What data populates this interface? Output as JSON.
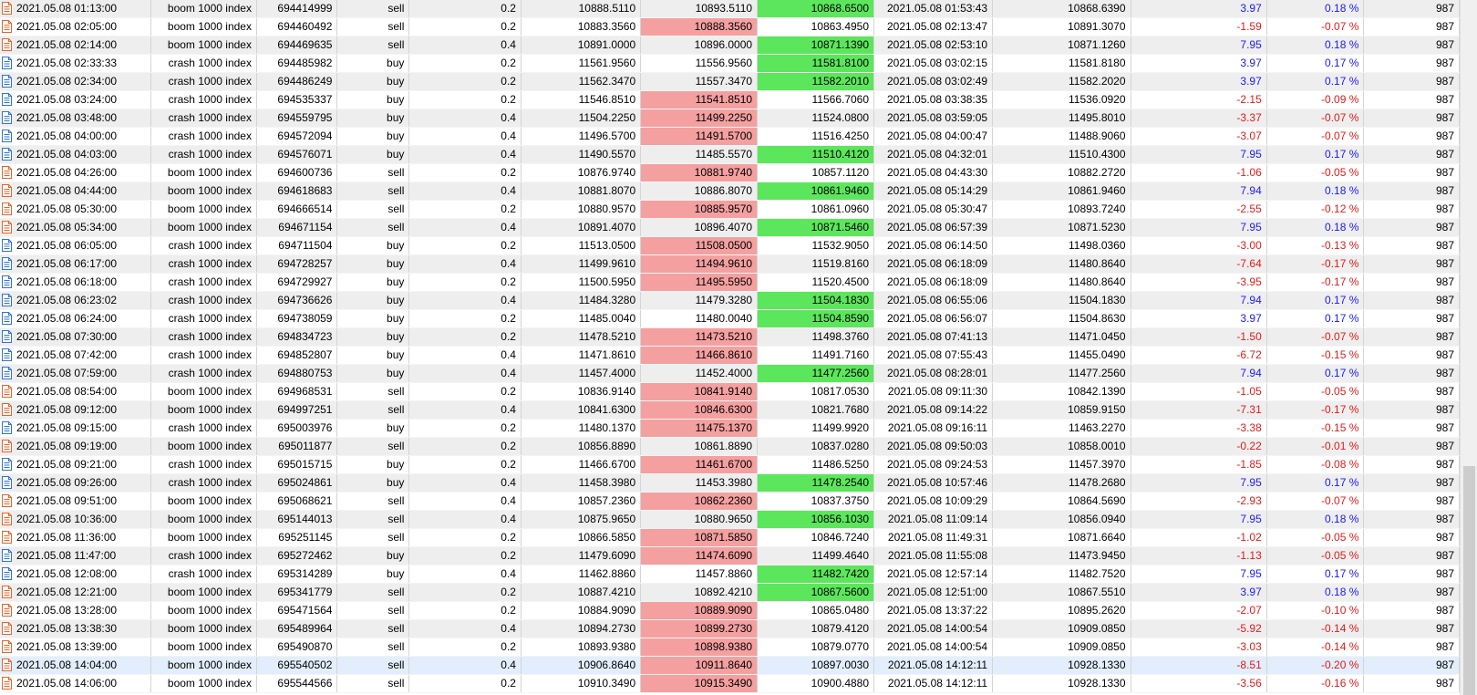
{
  "icons": {
    "sell": {
      "name": "sell-order-icon",
      "color": "#e8632b"
    },
    "buy": {
      "name": "buy-order-icon",
      "color": "#2f73d6"
    }
  },
  "colors": {
    "sl_hit": "#f4a0a0",
    "tp_hit": "#5ce65c",
    "profit_pos": "#1a1aff",
    "profit_neg": "#e21b1b",
    "row_even": "#eeeeee",
    "row_selected": "#e2eefb"
  },
  "scrollbar": {
    "thumb_start": 0.67,
    "thumb_end": 1.0
  },
  "rows": [
    {
      "time": "2021.05.08 01:13:00",
      "symbol": "boom 1000 index",
      "ticket": "694414999",
      "type": "sell",
      "volume": "0.2",
      "price": "10888.5110",
      "sl": "10893.5110",
      "tp": "10868.6500",
      "close_time": "2021.05.08 01:53:43",
      "close_price": "10868.6390",
      "profit": "3.97",
      "pct": "0.18 %",
      "magic": "987",
      "hit": "tp"
    },
    {
      "time": "2021.05.08 02:05:00",
      "symbol": "boom 1000 index",
      "ticket": "694460492",
      "type": "sell",
      "volume": "0.2",
      "price": "10883.3560",
      "sl": "10888.3560",
      "tp": "10863.4950",
      "close_time": "2021.05.08 02:13:47",
      "close_price": "10891.3070",
      "profit": "-1.59",
      "pct": "-0.07 %",
      "magic": "987",
      "hit": "sl"
    },
    {
      "time": "2021.05.08 02:14:00",
      "symbol": "boom 1000 index",
      "ticket": "694469635",
      "type": "sell",
      "volume": "0.4",
      "price": "10891.0000",
      "sl": "10896.0000",
      "tp": "10871.1390",
      "close_time": "2021.05.08 02:53:10",
      "close_price": "10871.1260",
      "profit": "7.95",
      "pct": "0.18 %",
      "magic": "987",
      "hit": "tp"
    },
    {
      "time": "2021.05.08 02:33:33",
      "symbol": "crash 1000 index",
      "ticket": "694485982",
      "type": "buy",
      "volume": "0.2",
      "price": "11561.9560",
      "sl": "11556.9560",
      "tp": "11581.8100",
      "close_time": "2021.05.08 03:02:15",
      "close_price": "11581.8180",
      "profit": "3.97",
      "pct": "0.17 %",
      "magic": "987",
      "hit": "tp"
    },
    {
      "time": "2021.05.08 02:34:00",
      "symbol": "crash 1000 index",
      "ticket": "694486249",
      "type": "buy",
      "volume": "0.2",
      "price": "11562.3470",
      "sl": "11557.3470",
      "tp": "11582.2010",
      "close_time": "2021.05.08 03:02:49",
      "close_price": "11582.2020",
      "profit": "3.97",
      "pct": "0.17 %",
      "magic": "987",
      "hit": "tp"
    },
    {
      "time": "2021.05.08 03:24:00",
      "symbol": "crash 1000 index",
      "ticket": "694535337",
      "type": "buy",
      "volume": "0.2",
      "price": "11546.8510",
      "sl": "11541.8510",
      "tp": "11566.7060",
      "close_time": "2021.05.08 03:38:35",
      "close_price": "11536.0920",
      "profit": "-2.15",
      "pct": "-0.09 %",
      "magic": "987",
      "hit": "sl"
    },
    {
      "time": "2021.05.08 03:48:00",
      "symbol": "crash 1000 index",
      "ticket": "694559795",
      "type": "buy",
      "volume": "0.4",
      "price": "11504.2250",
      "sl": "11499.2250",
      "tp": "11524.0800",
      "close_time": "2021.05.08 03:59:05",
      "close_price": "11495.8010",
      "profit": "-3.37",
      "pct": "-0.07 %",
      "magic": "987",
      "hit": "sl"
    },
    {
      "time": "2021.05.08 04:00:00",
      "symbol": "crash 1000 index",
      "ticket": "694572094",
      "type": "buy",
      "volume": "0.4",
      "price": "11496.5700",
      "sl": "11491.5700",
      "tp": "11516.4250",
      "close_time": "2021.05.08 04:00:47",
      "close_price": "11488.9060",
      "profit": "-3.07",
      "pct": "-0.07 %",
      "magic": "987",
      "hit": "sl"
    },
    {
      "time": "2021.05.08 04:03:00",
      "symbol": "crash 1000 index",
      "ticket": "694576071",
      "type": "buy",
      "volume": "0.4",
      "price": "11490.5570",
      "sl": "11485.5570",
      "tp": "11510.4120",
      "close_time": "2021.05.08 04:32:01",
      "close_price": "11510.4300",
      "profit": "7.95",
      "pct": "0.17 %",
      "magic": "987",
      "hit": "tp"
    },
    {
      "time": "2021.05.08 04:26:00",
      "symbol": "boom 1000 index",
      "ticket": "694600736",
      "type": "sell",
      "volume": "0.2",
      "price": "10876.9740",
      "sl": "10881.9740",
      "tp": "10857.1120",
      "close_time": "2021.05.08 04:43:30",
      "close_price": "10882.2720",
      "profit": "-1.06",
      "pct": "-0.05 %",
      "magic": "987",
      "hit": "sl"
    },
    {
      "time": "2021.05.08 04:44:00",
      "symbol": "boom 1000 index",
      "ticket": "694618683",
      "type": "sell",
      "volume": "0.4",
      "price": "10881.8070",
      "sl": "10886.8070",
      "tp": "10861.9460",
      "close_time": "2021.05.08 05:14:29",
      "close_price": "10861.9460",
      "profit": "7.94",
      "pct": "0.18 %",
      "magic": "987",
      "hit": "tp"
    },
    {
      "time": "2021.05.08 05:30:00",
      "symbol": "boom 1000 index",
      "ticket": "694666514",
      "type": "sell",
      "volume": "0.2",
      "price": "10880.9570",
      "sl": "10885.9570",
      "tp": "10861.0960",
      "close_time": "2021.05.08 05:30:47",
      "close_price": "10893.7240",
      "profit": "-2.55",
      "pct": "-0.12 %",
      "magic": "987",
      "hit": "sl"
    },
    {
      "time": "2021.05.08 05:34:00",
      "symbol": "boom 1000 index",
      "ticket": "694671154",
      "type": "sell",
      "volume": "0.4",
      "price": "10891.4070",
      "sl": "10896.4070",
      "tp": "10871.5460",
      "close_time": "2021.05.08 06:57:39",
      "close_price": "10871.5230",
      "profit": "7.95",
      "pct": "0.18 %",
      "magic": "987",
      "hit": "tp"
    },
    {
      "time": "2021.05.08 06:05:00",
      "symbol": "crash 1000 index",
      "ticket": "694711504",
      "type": "buy",
      "volume": "0.2",
      "price": "11513.0500",
      "sl": "11508.0500",
      "tp": "11532.9050",
      "close_time": "2021.05.08 06:14:50",
      "close_price": "11498.0360",
      "profit": "-3.00",
      "pct": "-0.13 %",
      "magic": "987",
      "hit": "sl"
    },
    {
      "time": "2021.05.08 06:17:00",
      "symbol": "crash 1000 index",
      "ticket": "694728257",
      "type": "buy",
      "volume": "0.4",
      "price": "11499.9610",
      "sl": "11494.9610",
      "tp": "11519.8160",
      "close_time": "2021.05.08 06:18:09",
      "close_price": "11480.8640",
      "profit": "-7.64",
      "pct": "-0.17 %",
      "magic": "987",
      "hit": "sl"
    },
    {
      "time": "2021.05.08 06:18:00",
      "symbol": "crash 1000 index",
      "ticket": "694729927",
      "type": "buy",
      "volume": "0.2",
      "price": "11500.5950",
      "sl": "11495.5950",
      "tp": "11520.4500",
      "close_time": "2021.05.08 06:18:09",
      "close_price": "11480.8640",
      "profit": "-3.95",
      "pct": "-0.17 %",
      "magic": "987",
      "hit": "sl"
    },
    {
      "time": "2021.05.08 06:23:02",
      "symbol": "crash 1000 index",
      "ticket": "694736626",
      "type": "buy",
      "volume": "0.4",
      "price": "11484.3280",
      "sl": "11479.3280",
      "tp": "11504.1830",
      "close_time": "2021.05.08 06:55:06",
      "close_price": "11504.1830",
      "profit": "7.94",
      "pct": "0.17 %",
      "magic": "987",
      "hit": "tp"
    },
    {
      "time": "2021.05.08 06:24:00",
      "symbol": "crash 1000 index",
      "ticket": "694738059",
      "type": "buy",
      "volume": "0.2",
      "price": "11485.0040",
      "sl": "11480.0040",
      "tp": "11504.8590",
      "close_time": "2021.05.08 06:56:07",
      "close_price": "11504.8630",
      "profit": "3.97",
      "pct": "0.17 %",
      "magic": "987",
      "hit": "tp"
    },
    {
      "time": "2021.05.08 07:30:00",
      "symbol": "crash 1000 index",
      "ticket": "694834723",
      "type": "buy",
      "volume": "0.2",
      "price": "11478.5210",
      "sl": "11473.5210",
      "tp": "11498.3760",
      "close_time": "2021.05.08 07:41:13",
      "close_price": "11471.0450",
      "profit": "-1.50",
      "pct": "-0.07 %",
      "magic": "987",
      "hit": "sl"
    },
    {
      "time": "2021.05.08 07:42:00",
      "symbol": "crash 1000 index",
      "ticket": "694852807",
      "type": "buy",
      "volume": "0.4",
      "price": "11471.8610",
      "sl": "11466.8610",
      "tp": "11491.7160",
      "close_time": "2021.05.08 07:55:43",
      "close_price": "11455.0490",
      "profit": "-6.72",
      "pct": "-0.15 %",
      "magic": "987",
      "hit": "sl"
    },
    {
      "time": "2021.05.08 07:59:00",
      "symbol": "crash 1000 index",
      "ticket": "694880753",
      "type": "buy",
      "volume": "0.4",
      "price": "11457.4000",
      "sl": "11452.4000",
      "tp": "11477.2560",
      "close_time": "2021.05.08 08:28:01",
      "close_price": "11477.2560",
      "profit": "7.94",
      "pct": "0.17 %",
      "magic": "987",
      "hit": "tp"
    },
    {
      "time": "2021.05.08 08:54:00",
      "symbol": "boom 1000 index",
      "ticket": "694968531",
      "type": "sell",
      "volume": "0.2",
      "price": "10836.9140",
      "sl": "10841.9140",
      "tp": "10817.0530",
      "close_time": "2021.05.08 09:11:30",
      "close_price": "10842.1390",
      "profit": "-1.05",
      "pct": "-0.05 %",
      "magic": "987",
      "hit": "sl"
    },
    {
      "time": "2021.05.08 09:12:00",
      "symbol": "boom 1000 index",
      "ticket": "694997251",
      "type": "sell",
      "volume": "0.4",
      "price": "10841.6300",
      "sl": "10846.6300",
      "tp": "10821.7680",
      "close_time": "2021.05.08 09:14:22",
      "close_price": "10859.9150",
      "profit": "-7.31",
      "pct": "-0.17 %",
      "magic": "987",
      "hit": "sl"
    },
    {
      "time": "2021.05.08 09:15:00",
      "symbol": "crash 1000 index",
      "ticket": "695003976",
      "type": "buy",
      "volume": "0.2",
      "price": "11480.1370",
      "sl": "11475.1370",
      "tp": "11499.9920",
      "close_time": "2021.05.08 09:16:11",
      "close_price": "11463.2270",
      "profit": "-3.38",
      "pct": "-0.15 %",
      "magic": "987",
      "hit": "sl"
    },
    {
      "time": "2021.05.08 09:19:00",
      "symbol": "boom 1000 index",
      "ticket": "695011877",
      "type": "sell",
      "volume": "0.2",
      "price": "10856.8890",
      "sl": "10861.8890",
      "tp": "10837.0280",
      "close_time": "2021.05.08 09:50:03",
      "close_price": "10858.0010",
      "profit": "-0.22",
      "pct": "-0.01 %",
      "magic": "987",
      "hit": ""
    },
    {
      "time": "2021.05.08 09:21:00",
      "symbol": "crash 1000 index",
      "ticket": "695015715",
      "type": "buy",
      "volume": "0.2",
      "price": "11466.6700",
      "sl": "11461.6700",
      "tp": "11486.5250",
      "close_time": "2021.05.08 09:24:53",
      "close_price": "11457.3970",
      "profit": "-1.85",
      "pct": "-0.08 %",
      "magic": "987",
      "hit": "sl"
    },
    {
      "time": "2021.05.08 09:26:00",
      "symbol": "crash 1000 index",
      "ticket": "695024861",
      "type": "buy",
      "volume": "0.4",
      "price": "11458.3980",
      "sl": "11453.3980",
      "tp": "11478.2540",
      "close_time": "2021.05.08 10:57:46",
      "close_price": "11478.2680",
      "profit": "7.95",
      "pct": "0.17 %",
      "magic": "987",
      "hit": "tp"
    },
    {
      "time": "2021.05.08 09:51:00",
      "symbol": "boom 1000 index",
      "ticket": "695068621",
      "type": "sell",
      "volume": "0.4",
      "price": "10857.2360",
      "sl": "10862.2360",
      "tp": "10837.3750",
      "close_time": "2021.05.08 10:09:29",
      "close_price": "10864.5690",
      "profit": "-2.93",
      "pct": "-0.07 %",
      "magic": "987",
      "hit": "sl"
    },
    {
      "time": "2021.05.08 10:36:00",
      "symbol": "boom 1000 index",
      "ticket": "695144013",
      "type": "sell",
      "volume": "0.4",
      "price": "10875.9650",
      "sl": "10880.9650",
      "tp": "10856.1030",
      "close_time": "2021.05.08 11:09:14",
      "close_price": "10856.0940",
      "profit": "7.95",
      "pct": "0.18 %",
      "magic": "987",
      "hit": "tp"
    },
    {
      "time": "2021.05.08 11:36:00",
      "symbol": "boom 1000 index",
      "ticket": "695251145",
      "type": "sell",
      "volume": "0.2",
      "price": "10866.5850",
      "sl": "10871.5850",
      "tp": "10846.7240",
      "close_time": "2021.05.08 11:49:31",
      "close_price": "10871.6640",
      "profit": "-1.02",
      "pct": "-0.05 %",
      "magic": "987",
      "hit": "sl"
    },
    {
      "time": "2021.05.08 11:47:00",
      "symbol": "crash 1000 index",
      "ticket": "695272462",
      "type": "buy",
      "volume": "0.2",
      "price": "11479.6090",
      "sl": "11474.6090",
      "tp": "11499.4640",
      "close_time": "2021.05.08 11:55:08",
      "close_price": "11473.9450",
      "profit": "-1.13",
      "pct": "-0.05 %",
      "magic": "987",
      "hit": "sl"
    },
    {
      "time": "2021.05.08 12:08:00",
      "symbol": "crash 1000 index",
      "ticket": "695314289",
      "type": "buy",
      "volume": "0.4",
      "price": "11462.8860",
      "sl": "11457.8860",
      "tp": "11482.7420",
      "close_time": "2021.05.08 12:57:14",
      "close_price": "11482.7520",
      "profit": "7.95",
      "pct": "0.17 %",
      "magic": "987",
      "hit": "tp"
    },
    {
      "time": "2021.05.08 12:21:00",
      "symbol": "boom 1000 index",
      "ticket": "695341779",
      "type": "sell",
      "volume": "0.2",
      "price": "10887.4210",
      "sl": "10892.4210",
      "tp": "10867.5600",
      "close_time": "2021.05.08 12:51:00",
      "close_price": "10867.5510",
      "profit": "3.97",
      "pct": "0.18 %",
      "magic": "987",
      "hit": "tp"
    },
    {
      "time": "2021.05.08 13:28:00",
      "symbol": "boom 1000 index",
      "ticket": "695471564",
      "type": "sell",
      "volume": "0.2",
      "price": "10884.9090",
      "sl": "10889.9090",
      "tp": "10865.0480",
      "close_time": "2021.05.08 13:37:22",
      "close_price": "10895.2620",
      "profit": "-2.07",
      "pct": "-0.10 %",
      "magic": "987",
      "hit": "sl"
    },
    {
      "time": "2021.05.08 13:38:30",
      "symbol": "boom 1000 index",
      "ticket": "695489964",
      "type": "sell",
      "volume": "0.4",
      "price": "10894.2730",
      "sl": "10899.2730",
      "tp": "10879.4120",
      "close_time": "2021.05.08 14:00:54",
      "close_price": "10909.0850",
      "profit": "-5.92",
      "pct": "-0.14 %",
      "magic": "987",
      "hit": "sl"
    },
    {
      "time": "2021.05.08 13:39:00",
      "symbol": "boom 1000 index",
      "ticket": "695490870",
      "type": "sell",
      "volume": "0.2",
      "price": "10893.9380",
      "sl": "10898.9380",
      "tp": "10879.0770",
      "close_time": "2021.05.08 14:00:54",
      "close_price": "10909.0850",
      "profit": "-3.03",
      "pct": "-0.14 %",
      "magic": "987",
      "hit": "sl"
    },
    {
      "time": "2021.05.08 14:04:00",
      "symbol": "boom 1000 index",
      "ticket": "695540502",
      "type": "sell",
      "volume": "0.4",
      "price": "10906.8640",
      "sl": "10911.8640",
      "tp": "10897.0030",
      "close_time": "2021.05.08 14:12:11",
      "close_price": "10928.1330",
      "profit": "-8.51",
      "pct": "-0.20 %",
      "magic": "987",
      "hit": "sl",
      "selected": true
    },
    {
      "time": "2021.05.08 14:06:00",
      "symbol": "boom 1000 index",
      "ticket": "695544566",
      "type": "sell",
      "volume": "0.2",
      "price": "10910.3490",
      "sl": "10915.3490",
      "tp": "10900.4880",
      "close_time": "2021.05.08 14:12:11",
      "close_price": "10928.1330",
      "profit": "-3.56",
      "pct": "-0.16 %",
      "magic": "987",
      "hit": "sl"
    }
  ]
}
